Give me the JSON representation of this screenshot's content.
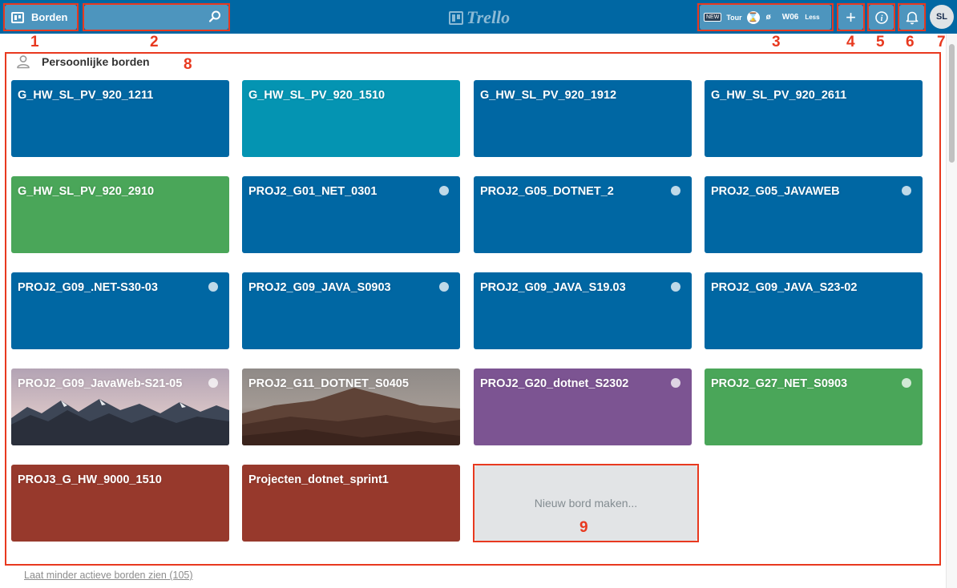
{
  "header": {
    "boards_button_label": "Borden",
    "search_placeholder": "",
    "logo_text": "Trello",
    "extension": {
      "new_badge": "NEW",
      "tour_label": "Tour",
      "hourglass_icon": "hourglass-icon",
      "slash_label": "ø",
      "week_label": "W06",
      "less_label": "Less"
    },
    "add_label": "+",
    "avatar_initials": "SL"
  },
  "annotations": [
    "1",
    "2",
    "3",
    "4",
    "5",
    "6",
    "7",
    "8",
    "9"
  ],
  "section": {
    "title": "Persoonlijke borden"
  },
  "boards": [
    {
      "name": "G_HW_SL_PV_920_1211",
      "color": "#0067a3",
      "starred": false
    },
    {
      "name": "G_HW_SL_PV_920_1510",
      "color": "#0494b2",
      "starred": false
    },
    {
      "name": "G_HW_SL_PV_920_1912",
      "color": "#0067a3",
      "starred": false
    },
    {
      "name": "G_HW_SL_PV_920_2611",
      "color": "#0067a3",
      "starred": false
    },
    {
      "name": "G_HW_SL_PV_920_2910",
      "color": "#4aa659",
      "starred": false
    },
    {
      "name": "PROJ2_G01_NET_0301",
      "color": "#0067a3",
      "starred": true
    },
    {
      "name": "PROJ2_G05_DOTNET_2",
      "color": "#0067a3",
      "starred": true
    },
    {
      "name": "PROJ2_G05_JAVAWEB",
      "color": "#0067a3",
      "starred": true
    },
    {
      "name": "PROJ2_G09_.NET-S30-03",
      "color": "#0067a3",
      "starred": true
    },
    {
      "name": "PROJ2_G09_JAVA_S0903",
      "color": "#0067a3",
      "starred": true
    },
    {
      "name": "PROJ2_G09_JAVA_S19.03",
      "color": "#0067a3",
      "starred": true
    },
    {
      "name": "PROJ2_G09_JAVA_S23-02",
      "color": "#0067a3",
      "starred": false
    },
    {
      "name": "PROJ2_G09_JavaWeb-S21-05",
      "color": "mountains",
      "starred": true
    },
    {
      "name": "PROJ2_G11_DOTNET_S0405",
      "color": "desert",
      "starred": false
    },
    {
      "name": "PROJ2_G20_dotnet_S2302",
      "color": "#7c5492",
      "starred": true
    },
    {
      "name": "PROJ2_G27_NET_S0903",
      "color": "#4aa659",
      "starred": true
    },
    {
      "name": "PROJ3_G_HW_9000_1510",
      "color": "#97392c",
      "starred": false
    },
    {
      "name": "Projecten_dotnet_sprint1",
      "color": "#97392c",
      "starred": false
    }
  ],
  "new_board_label": "Nieuw bord maken...",
  "footer_link": "Laat minder actieve borden zien (105)"
}
